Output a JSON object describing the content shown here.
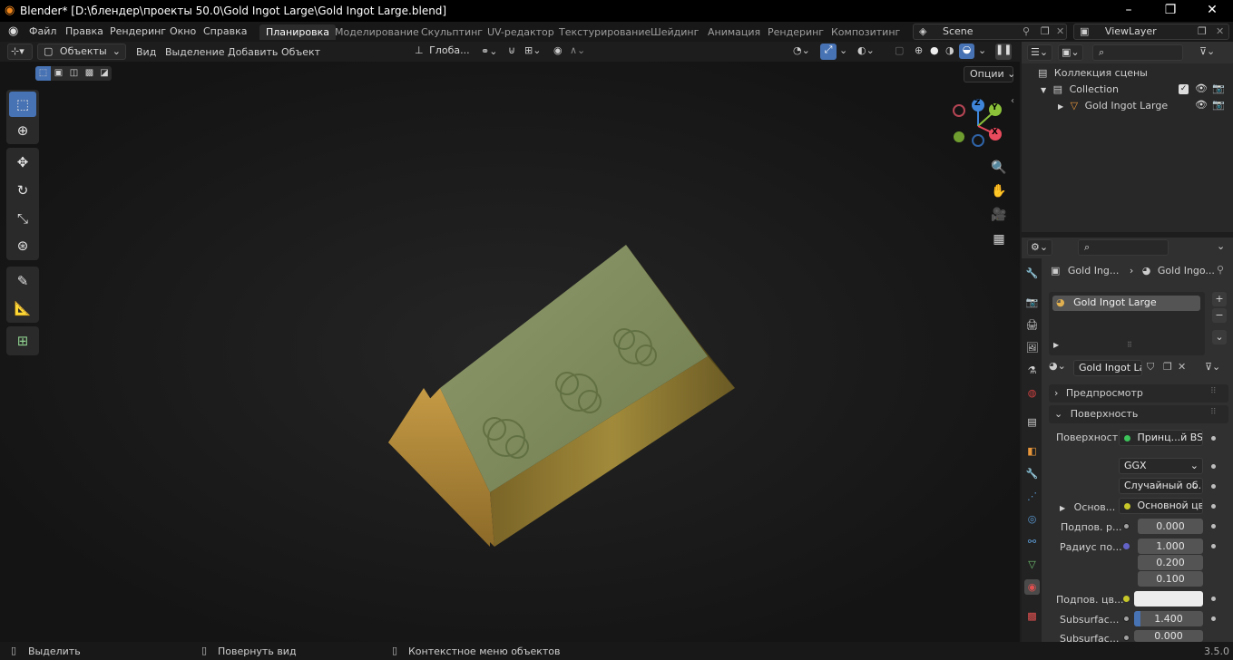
{
  "titlebar": {
    "title": "Blender* [D:\\блендер\\проекты 50.0\\Gold Ingot Large\\Gold Ingot Large.blend]",
    "minimize": "–",
    "maximize": "❐",
    "close": "✕"
  },
  "menu": {
    "items": [
      "Файл",
      "Правка",
      "Рендеринг",
      "Окно",
      "Справка"
    ]
  },
  "workspaces": {
    "tabs": [
      "Планировка",
      "Моделирование",
      "Скульптинг",
      "UV-редактор",
      "Текстурирование",
      "Шейдинг",
      "Анимация",
      "Рендеринг",
      "Композитинг"
    ],
    "active": "Планировка"
  },
  "scene": {
    "name": "Scene",
    "view_layer": "ViewLayer"
  },
  "viewport_header": {
    "mode": "Объекты",
    "menus": [
      "Вид",
      "Выделение",
      "Добавить",
      "Объект"
    ],
    "transform_orientation": "Глоба...",
    "options": "Опции"
  },
  "gizmo": {
    "z": "Z",
    "y": "Y",
    "x": "X",
    "colors": {
      "x": "#e84b5d",
      "y": "#8bc23a",
      "z": "#3f86db"
    }
  },
  "outliner": {
    "root": "Коллекция сцены",
    "collection": "Collection",
    "object": "Gold Ingot Large"
  },
  "properties": {
    "breadcrumb_object": "Gold Ing...",
    "breadcrumb_material": "Gold Ingo...",
    "material_slot": "Gold Ingot Large",
    "material_name": "Gold Ingot La...",
    "sections": {
      "preview": "Предпросмотр",
      "surface": "Поверхность"
    },
    "surface_label": "Поверхность",
    "surface_value": "Принц...й BSDF",
    "distribution": "GGX",
    "subsurface_method": "Случайный об...",
    "base_label": "Основ...",
    "base_value": "Основной цвет",
    "subsurface_label": "Подпов. р...",
    "subsurface_value": "0.000",
    "radius_label": "Радиус по...",
    "radius_values": [
      "1.000",
      "0.200",
      "0.100"
    ],
    "subsurface_color_label": "Подпов. цв...",
    "subsurface_ior_label": "Subsurfac...",
    "subsurface_ior_value": "1.400",
    "subsurface_aniso_label": "Subsurfac...",
    "subsurface_aniso_value": "0.000"
  },
  "statusbar": {
    "select": "Выделить",
    "rotate": "Повернуть вид",
    "context": "Контекстное меню объектов",
    "version": "3.5.0"
  }
}
